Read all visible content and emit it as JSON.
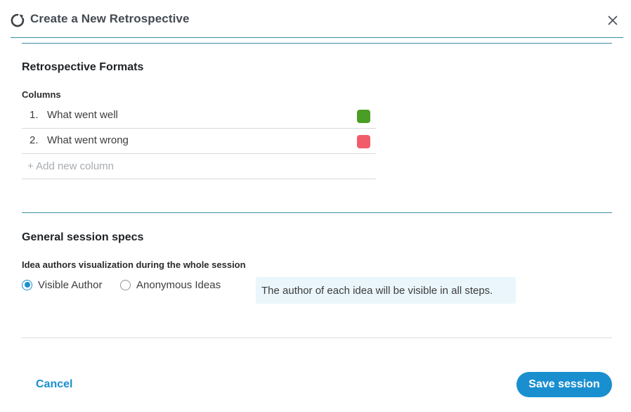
{
  "dialog": {
    "title": "Create a New Retrospective"
  },
  "formats": {
    "section_title": "Retrospective Formats",
    "columns_label": "Columns",
    "columns": [
      {
        "number": "1.",
        "name": "What went well",
        "color": "#4a9e26"
      },
      {
        "number": "2.",
        "name": "What went wrong",
        "color": "#f25c6a"
      }
    ],
    "add_column_label": "+ Add new column"
  },
  "specs": {
    "section_title": "General session specs",
    "visualization_label": "Idea authors visualization during the whole session",
    "options": [
      {
        "label": "Visible Author",
        "selected": true
      },
      {
        "label": "Anonymous Ideas",
        "selected": false
      }
    ],
    "hint": "The author of each idea will be visible in all steps."
  },
  "footer": {
    "cancel_label": "Cancel",
    "save_label": "Save session"
  },
  "colors": {
    "accent": "#1a8fd0",
    "divider": "#3a8fa0"
  }
}
